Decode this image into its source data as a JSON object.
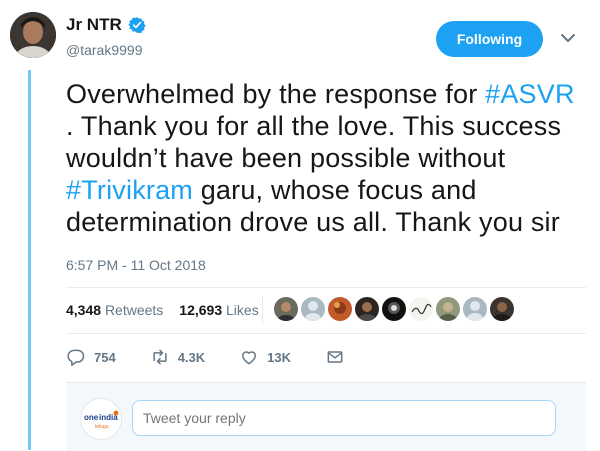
{
  "author": {
    "name": "Jr NTR",
    "handle": "@tarak9999",
    "verified": true
  },
  "follow_button": {
    "label": "Following",
    "color": "#1da1f2"
  },
  "tweet": {
    "segments": [
      {
        "text": "Overwhelmed by the response for ",
        "tag": false
      },
      {
        "text": "#ASVR",
        "tag": true
      },
      {
        "text": " . Thank you for all the love. This success wouldn’t have been possible without ",
        "tag": false
      },
      {
        "text": "#Trivikram",
        "tag": true
      },
      {
        "text": " garu, whose focus and determination drove us all. Thank you sir",
        "tag": false
      }
    ],
    "timestamp": "6:57 PM - 11 Oct 2018"
  },
  "stats": {
    "retweets_count": "4,348",
    "retweets_label": "Retweets",
    "likes_count": "12,693",
    "likes_label": "Likes"
  },
  "likers": [
    "person-1",
    "default-1",
    "person-2",
    "person-3",
    "person-4",
    "signature",
    "person-5",
    "default-2",
    "person-6"
  ],
  "actions": {
    "reply_count": "754",
    "retweet_count": "4.3K",
    "like_count": "13K"
  },
  "reply": {
    "placeholder": "Tweet your reply",
    "avatar_logo": "oneindia",
    "avatar_sub": "telugu"
  },
  "colors": {
    "accent": "#1da1f2",
    "rule": "#71c9f8",
    "muted": "#657786"
  }
}
